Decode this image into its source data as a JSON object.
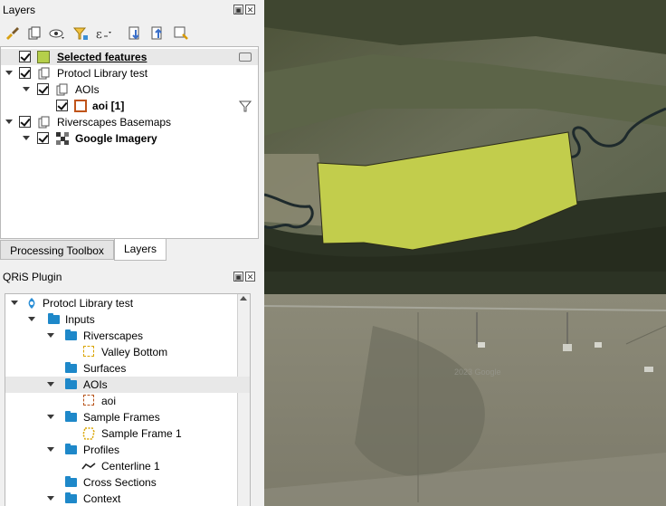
{
  "layers_panel": {
    "title": "Layers",
    "toolbar_icons": [
      "paint-brush-icon",
      "add-group-icon",
      "eye-icon",
      "filter-icon",
      "expression-filter-icon",
      "expand-all-icon",
      "collapse-all-icon",
      "remove-layer-icon"
    ],
    "tree": [
      {
        "label": "Selected features",
        "level": 0
      },
      {
        "label": "Protocl Library test",
        "level": 0
      },
      {
        "label": "AOIs",
        "level": 1
      },
      {
        "label": "aoi [1]",
        "level": 2
      },
      {
        "label": "Riverscapes Basemaps",
        "level": 0
      },
      {
        "label": "Google Imagery",
        "level": 1
      }
    ]
  },
  "tabs": [
    {
      "label": "Processing Toolbox",
      "active": false
    },
    {
      "label": "Layers",
      "active": true
    }
  ],
  "qris_panel": {
    "title": "QRiS Plugin",
    "tree": [
      {
        "label": "Protocl Library test"
      },
      {
        "label": "Inputs"
      },
      {
        "label": "Riverscapes"
      },
      {
        "label": "Valley Bottom"
      },
      {
        "label": "Surfaces"
      },
      {
        "label": "AOIs"
      },
      {
        "label": "aoi"
      },
      {
        "label": "Sample Frames"
      },
      {
        "label": "Sample Frame 1"
      },
      {
        "label": "Profiles"
      },
      {
        "label": "Centerline 1"
      },
      {
        "label": "Cross Sections"
      },
      {
        "label": "Context"
      }
    ]
  },
  "map": {
    "polygon_fill": "#c2cd4c",
    "watermark": "2023 Google"
  },
  "colors": {
    "folder": "#1e88c9",
    "selected_features_swatch": "#b5cf4a",
    "highlight_row": "#e8e8e8"
  }
}
